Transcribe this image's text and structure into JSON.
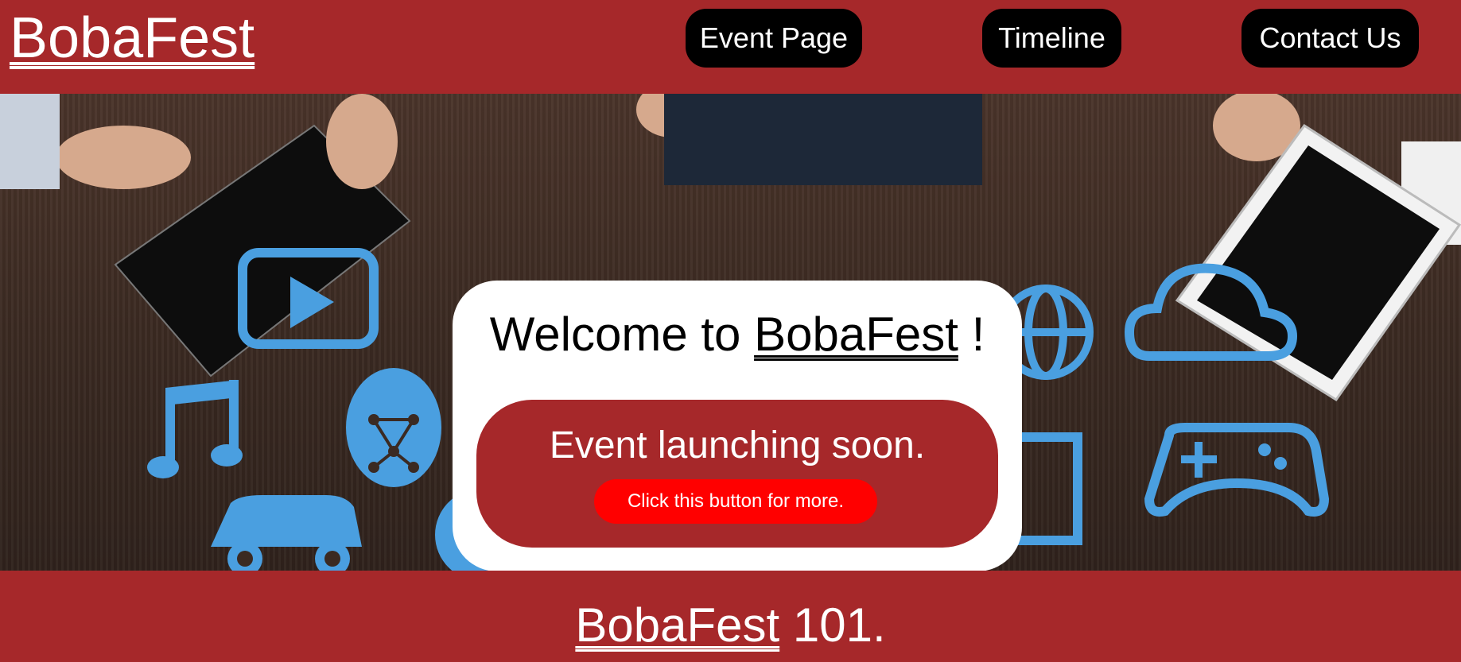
{
  "header": {
    "logo": "BobaFest",
    "nav": [
      "Event Page",
      "Timeline",
      "Contact Us"
    ]
  },
  "hero": {
    "welcome_prefix": "Welcome to ",
    "welcome_brand": "BobaFest",
    "welcome_suffix": " !",
    "launch_text": "Event launching soon.",
    "button_label": "Click this button for more."
  },
  "section": {
    "brand": "BobaFest",
    "suffix": " 101."
  },
  "colors": {
    "primary_red": "#a6282a",
    "button_red": "#ff0000",
    "nav_black": "#000000",
    "icon_blue": "#4a9fe0"
  },
  "hero_icons": [
    "play-icon",
    "music-note-icon",
    "face-scan-icon",
    "car-icon",
    "disc-icon",
    "chip-brain-icon",
    "globe-icon",
    "cloud-icon",
    "gamepad-icon",
    "monitor-icon"
  ]
}
